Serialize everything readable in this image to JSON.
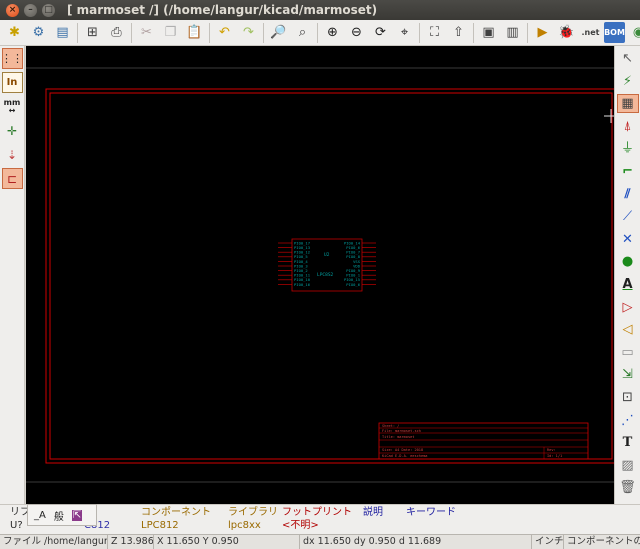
{
  "window": {
    "title": "[ marmoset /] (/home/langur/kicad/marmoset)",
    "close_glyph": "×",
    "min_glyph": "–",
    "max_glyph": "□"
  },
  "toolbar": {
    "items": [
      {
        "name": "new-sheet-icon",
        "glyph": "✱"
      },
      {
        "name": "sheet-settings-icon",
        "glyph": "⚙"
      },
      {
        "name": "save-icon",
        "glyph": "▤"
      },
      {
        "name": "page-settings-icon",
        "glyph": "⊞"
      },
      {
        "name": "print-icon",
        "glyph": "⎙"
      },
      {
        "name": "cut-icon",
        "glyph": "✂"
      },
      {
        "name": "copy-icon",
        "glyph": "❐"
      },
      {
        "name": "paste-icon",
        "glyph": "📋"
      },
      {
        "name": "undo-icon",
        "glyph": "↶"
      },
      {
        "name": "redo-icon",
        "glyph": "↷"
      },
      {
        "name": "find-icon",
        "glyph": "🔎"
      },
      {
        "name": "find-replace-icon",
        "glyph": "⌕"
      },
      {
        "name": "zoom-in-icon",
        "glyph": "⊕"
      },
      {
        "name": "zoom-out-icon",
        "glyph": "⊖"
      },
      {
        "name": "zoom-redraw-icon",
        "glyph": "⟳"
      },
      {
        "name": "zoom-fit-icon",
        "glyph": "⌖"
      },
      {
        "name": "hierarchy-navigator-icon",
        "glyph": "⛶"
      },
      {
        "name": "leave-sheet-icon",
        "glyph": "⇧"
      },
      {
        "name": "library-editor-icon",
        "glyph": "▣"
      },
      {
        "name": "library-browser-icon",
        "glyph": "▥"
      },
      {
        "name": "annotate-icon",
        "glyph": "▶"
      },
      {
        "name": "erc-icon",
        "glyph": "🐞"
      },
      {
        "name": "netlist-icon",
        "glyph": ".net"
      },
      {
        "name": "bom-icon",
        "glyph": "BOM"
      },
      {
        "name": "cvpcb-icon",
        "glyph": "◉"
      },
      {
        "name": "pcbnew-icon",
        "glyph": "▦"
      }
    ]
  },
  "left_toolbar": {
    "grid_glyph": "⋮⋮",
    "units_in": "In",
    "units_mm": "mm",
    "mm_arrows": "↔",
    "cursor_glyph": "✛",
    "pin_glyph": "⇣",
    "bus_glyph": "⊏"
  },
  "right_toolbar": {
    "items": [
      {
        "name": "select-tool-icon",
        "glyph": "↖"
      },
      {
        "name": "highlight-net-icon",
        "glyph": "⚡"
      },
      {
        "name": "hierarchy-nav-icon",
        "glyph": "▦"
      },
      {
        "name": "add-component-icon",
        "glyph": "⍋"
      },
      {
        "name": "add-power-icon",
        "glyph": "⏚"
      },
      {
        "name": "add-wire-icon",
        "glyph": "⌐"
      },
      {
        "name": "add-bus-icon",
        "glyph": "⫽"
      },
      {
        "name": "add-wire-entry-icon",
        "glyph": "⟋"
      },
      {
        "name": "no-connect-icon",
        "glyph": "✕"
      },
      {
        "name": "add-junction-icon",
        "glyph": "●"
      },
      {
        "name": "add-label-icon",
        "glyph": "A"
      },
      {
        "name": "add-global-label-icon",
        "glyph": "▷"
      },
      {
        "name": "add-hier-label-icon",
        "glyph": "◁"
      },
      {
        "name": "add-sheet-icon",
        "glyph": "▭"
      },
      {
        "name": "import-sheet-pin-icon",
        "glyph": "⇲"
      },
      {
        "name": "add-sheet-pin-icon",
        "glyph": "⊡"
      },
      {
        "name": "add-graphic-line-icon",
        "glyph": "⋰"
      },
      {
        "name": "add-text-icon",
        "glyph": "T"
      },
      {
        "name": "add-image-icon",
        "glyph": "▨"
      },
      {
        "name": "delete-icon",
        "glyph": "🗑"
      }
    ]
  },
  "schematic": {
    "ref": "U2",
    "value": "LPC8S2",
    "left_pins": [
      "PIO0_17",
      "PIO0_13",
      "PIO0_12",
      "PIO0_5",
      "PIO0_4",
      "PIO0_3",
      "PIO0_2",
      "PIO0_11",
      "PIO0_10",
      "PIO0_16"
    ],
    "right_pins": [
      "PIO0_14",
      "PIO0_6",
      "PIO0_7",
      "PIO0_8",
      "VSS",
      "VDD",
      "PIO0_9",
      "PIO0_1",
      "PIO0_15",
      "PIO0_6"
    ],
    "title_block": [
      "Sheet: /",
      "File: marmoset.sch",
      "Title: marmoset",
      "Size: A4    Date: 2018",
      "KiCad E.D.A.  eeschema",
      "Rev:",
      "Id: 1/1"
    ],
    "colors": {
      "border": "#d00000",
      "pin_names": "#00a0a0",
      "pin_numbers": "#c00000",
      "body": "#c00000"
    }
  },
  "component_panel": {
    "popup_labels": [
      "_A",
      "般",
      "⇱"
    ],
    "row_labels": [
      "リフ",
      "U?"
    ],
    "headers": {
      "name": "前",
      "component": "コンポーネント",
      "library": "ライブラリ",
      "footprint": "フットプリント",
      "description": "説明",
      "keywords": "キーワード"
    },
    "values": {
      "name": "C812",
      "component": "LPC812",
      "library": "lpc8xx",
      "footprint": "<不明>"
    }
  },
  "status": {
    "file": "ファイル /home/langur/kicad/marmo",
    "zoom": "Z 13.9868",
    "xy": "X 11.650  Y 0.950",
    "delta": "dx 11.650  dy 0.950  d 11.689",
    "units": "インチ",
    "mode": "コンポーネントの"
  }
}
